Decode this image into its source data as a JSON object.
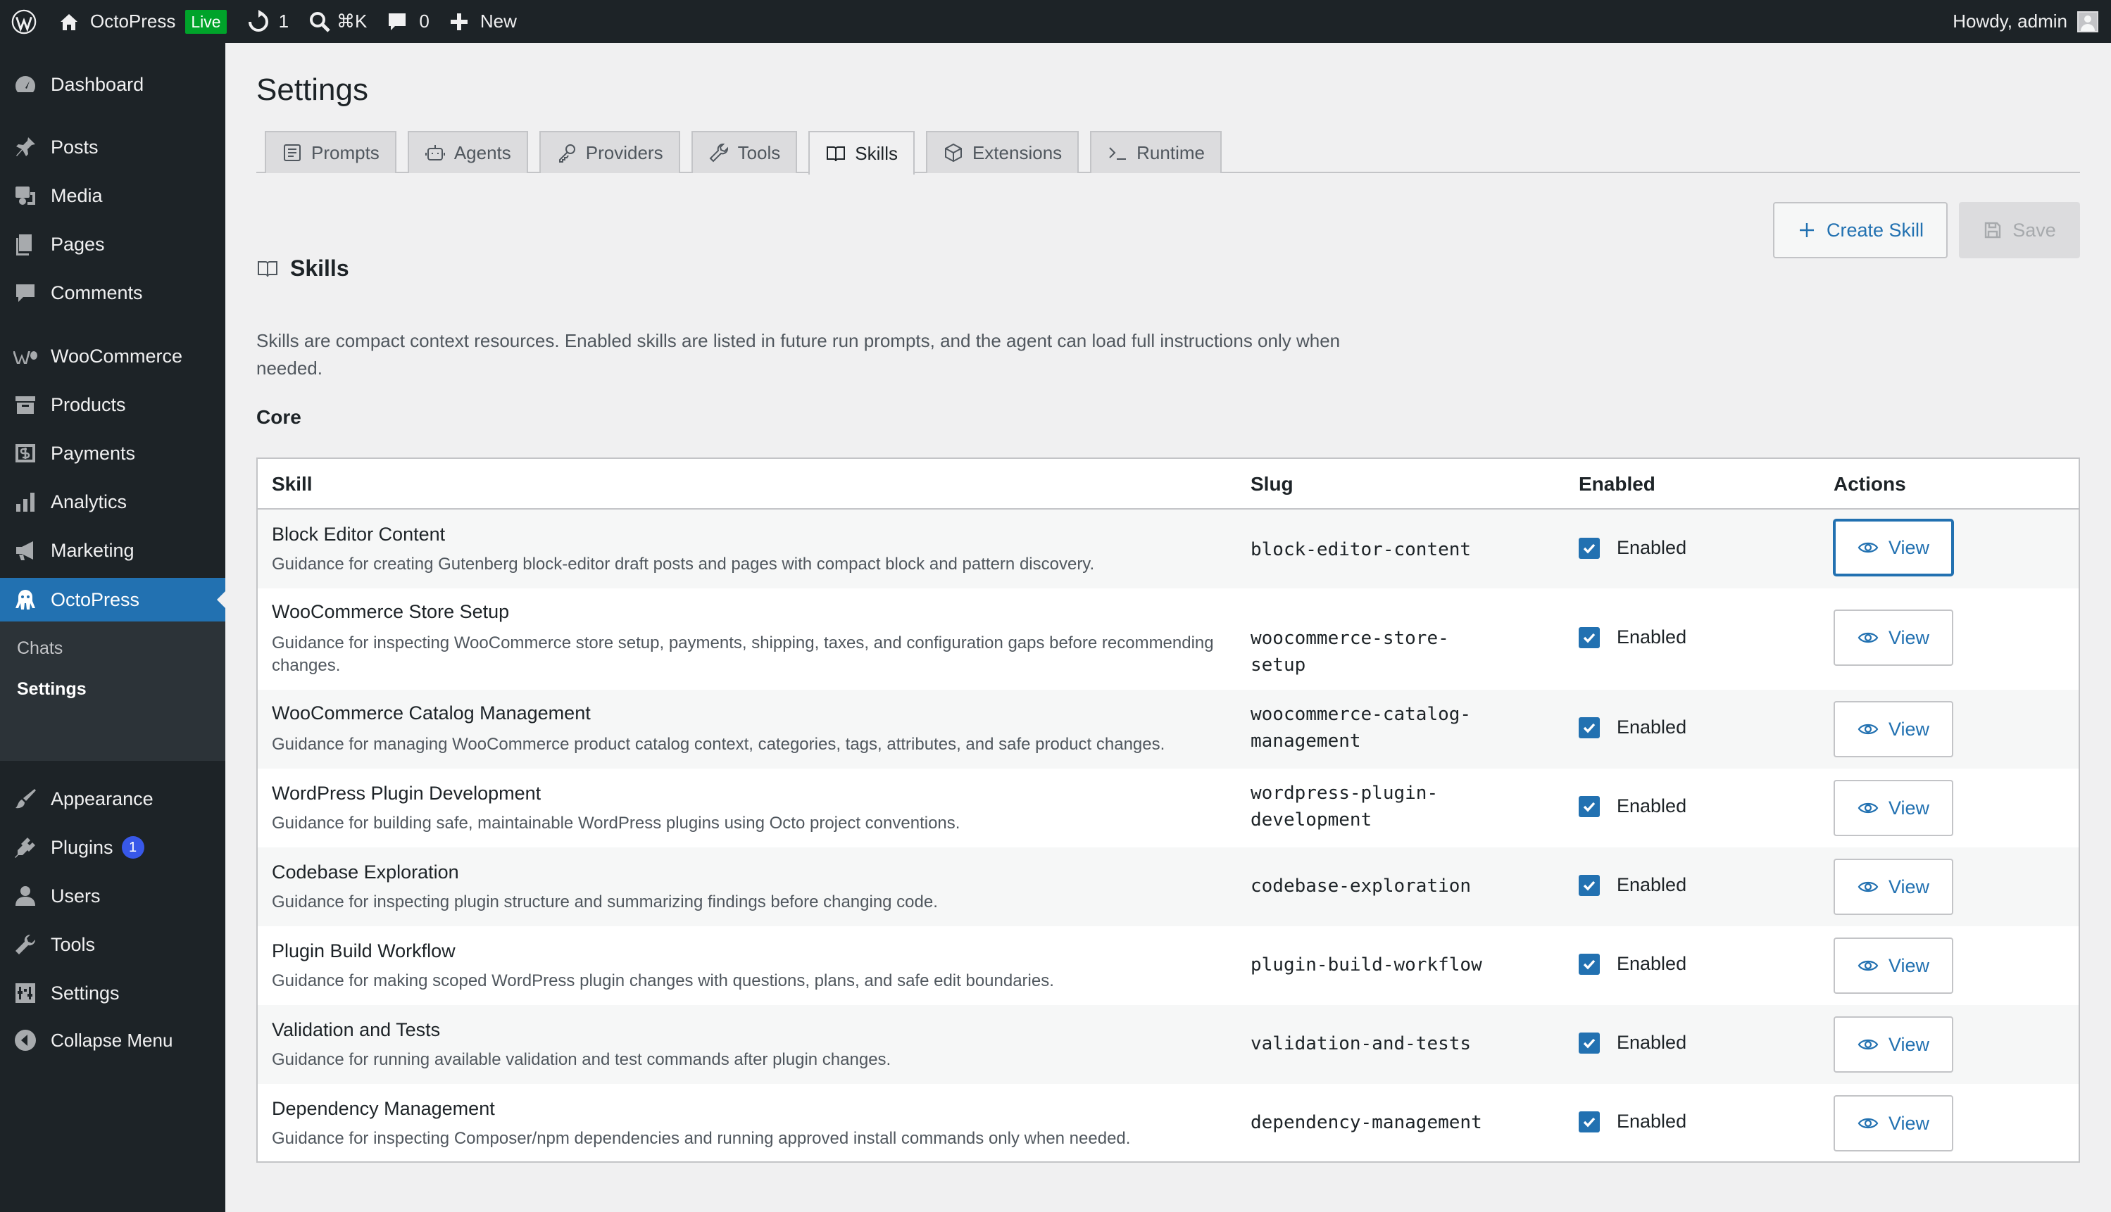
{
  "adminbar": {
    "site_name": "OctoPress",
    "live_badge": "Live",
    "updates_count": "1",
    "search_shortcut": "⌘K",
    "comments_count": "0",
    "new_label": "New",
    "howdy": "Howdy, admin"
  },
  "sidebar": {
    "items": [
      {
        "label": "Dashboard",
        "icon": "dashboard-icon"
      },
      {
        "label": "Posts",
        "icon": "pin-icon"
      },
      {
        "label": "Media",
        "icon": "media-icon"
      },
      {
        "label": "Pages",
        "icon": "pages-icon"
      },
      {
        "label": "Comments",
        "icon": "comment-icon"
      },
      {
        "label": "WooCommerce",
        "icon": "woo-icon"
      },
      {
        "label": "Products",
        "icon": "archive-icon"
      },
      {
        "label": "Payments",
        "icon": "payments-icon"
      },
      {
        "label": "Analytics",
        "icon": "chart-icon"
      },
      {
        "label": "Marketing",
        "icon": "megaphone-icon"
      },
      {
        "label": "OctoPress",
        "icon": "octopus-icon"
      },
      {
        "label": "Appearance",
        "icon": "brush-icon"
      },
      {
        "label": "Plugins",
        "icon": "plug-icon",
        "badge": "1"
      },
      {
        "label": "Users",
        "icon": "user-icon"
      },
      {
        "label": "Tools",
        "icon": "wrench-icon"
      },
      {
        "label": "Settings",
        "icon": "sliders-icon"
      },
      {
        "label": "Collapse Menu",
        "icon": "collapse-icon"
      }
    ],
    "submenu": [
      "Chats",
      "Settings"
    ]
  },
  "page": {
    "title": "Settings",
    "tabs": [
      "Prompts",
      "Agents",
      "Providers",
      "Tools",
      "Skills",
      "Extensions",
      "Runtime"
    ],
    "active_tab": "Skills",
    "section_title": "Skills",
    "create_label": "Create Skill",
    "save_label": "Save",
    "description": "Skills are compact context resources. Enabled skills are listed in future run prompts, and the agent can load full instructions only when needed.",
    "group_title": "Core"
  },
  "table": {
    "headers": [
      "Skill",
      "Slug",
      "Enabled",
      "Actions"
    ],
    "rows": [
      {
        "name": "Block Editor Content",
        "desc": "Guidance for creating Gutenberg block-editor draft posts and pages with compact block and pattern discovery.",
        "slug": "block-editor-content",
        "enabled": "Enabled",
        "action": "View"
      },
      {
        "name": "WooCommerce Store Setup",
        "desc": "Guidance for inspecting WooCommerce store setup, payments, shipping, taxes, and configuration gaps before recommending changes.",
        "slug": "woocommerce-store-setup",
        "enabled": "Enabled",
        "action": "View"
      },
      {
        "name": "WooCommerce Catalog Management",
        "desc": "Guidance for managing WooCommerce product catalog context, categories, tags, attributes, and safe product changes.",
        "slug": "woocommerce-catalog-management",
        "enabled": "Enabled",
        "action": "View"
      },
      {
        "name": "WordPress Plugin Development",
        "desc": "Guidance for building safe, maintainable WordPress plugins using Octo project conventions.",
        "slug": "wordpress-plugin-development",
        "enabled": "Enabled",
        "action": "View"
      },
      {
        "name": "Codebase Exploration",
        "desc": "Guidance for inspecting plugin structure and summarizing findings before changing code.",
        "slug": "codebase-exploration",
        "enabled": "Enabled",
        "action": "View"
      },
      {
        "name": "Plugin Build Workflow",
        "desc": "Guidance for making scoped WordPress plugin changes with questions, plans, and safe edit boundaries.",
        "slug": "plugin-build-workflow",
        "enabled": "Enabled",
        "action": "View"
      },
      {
        "name": "Validation and Tests",
        "desc": "Guidance for running available validation and test commands after plugin changes.",
        "slug": "validation-and-tests",
        "enabled": "Enabled",
        "action": "View"
      },
      {
        "name": "Dependency Management",
        "desc": "Guidance for inspecting Composer/npm dependencies and running approved install commands only when needed.",
        "slug": "dependency-management",
        "enabled": "Enabled",
        "action": "View"
      }
    ]
  },
  "colors": {
    "accent": "#2271b1",
    "adminbar": "#1d2327",
    "live": "#00a32a"
  }
}
